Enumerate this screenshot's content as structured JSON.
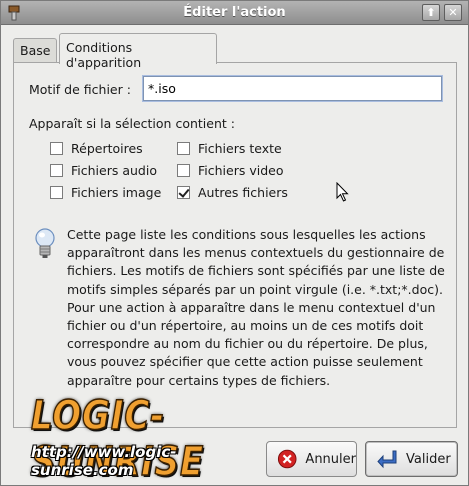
{
  "window": {
    "title": "Éditer l'action",
    "up_glyph": "⬆",
    "close_glyph": "✕"
  },
  "tabs": [
    {
      "label": "Base"
    },
    {
      "label": "Conditions d'apparition"
    }
  ],
  "pattern": {
    "label": "Motif de fichier :",
    "value": "*.iso"
  },
  "contains": {
    "label": "Apparaît si la sélection contient :",
    "options": [
      {
        "label": "Répertoires",
        "checked": false
      },
      {
        "label": "Fichiers texte",
        "checked": false
      },
      {
        "label": "Fichiers audio",
        "checked": false
      },
      {
        "label": "Fichiers video",
        "checked": false
      },
      {
        "label": "Fichiers image",
        "checked": false
      },
      {
        "label": "Autres fichiers",
        "checked": true
      }
    ]
  },
  "info": {
    "icon": "lightbulb-icon",
    "text": "Cette page liste les conditions sous lesquelles les actions apparaîtront dans les menus contextuels du gestionnaire de fichiers. Les motifs de fichiers sont spécifiés par une liste de motifs simples séparés par un point virgule (i.e. *.txt;*.doc). Pour une action à apparaître dans le menu contextuel d'un fichier ou d'un répertoire, au moins un de ces motifs doit correspondre au nom du fichier ou du répertoire. De plus, vous pouvez spécifier que cette action puisse seulement apparaître pour certains types de fichiers."
  },
  "watermark": {
    "main": "LOGIC-SUNRISE",
    "url": "http://www.logic-sunrise.com"
  },
  "buttons": {
    "cancel": "Annuler",
    "ok": "Valider"
  },
  "colors": {
    "titlebar": "#9e9e9e",
    "cancel_icon": "#d22222",
    "ok_icon": "#3b6cc4",
    "logo": "#f0a030"
  }
}
